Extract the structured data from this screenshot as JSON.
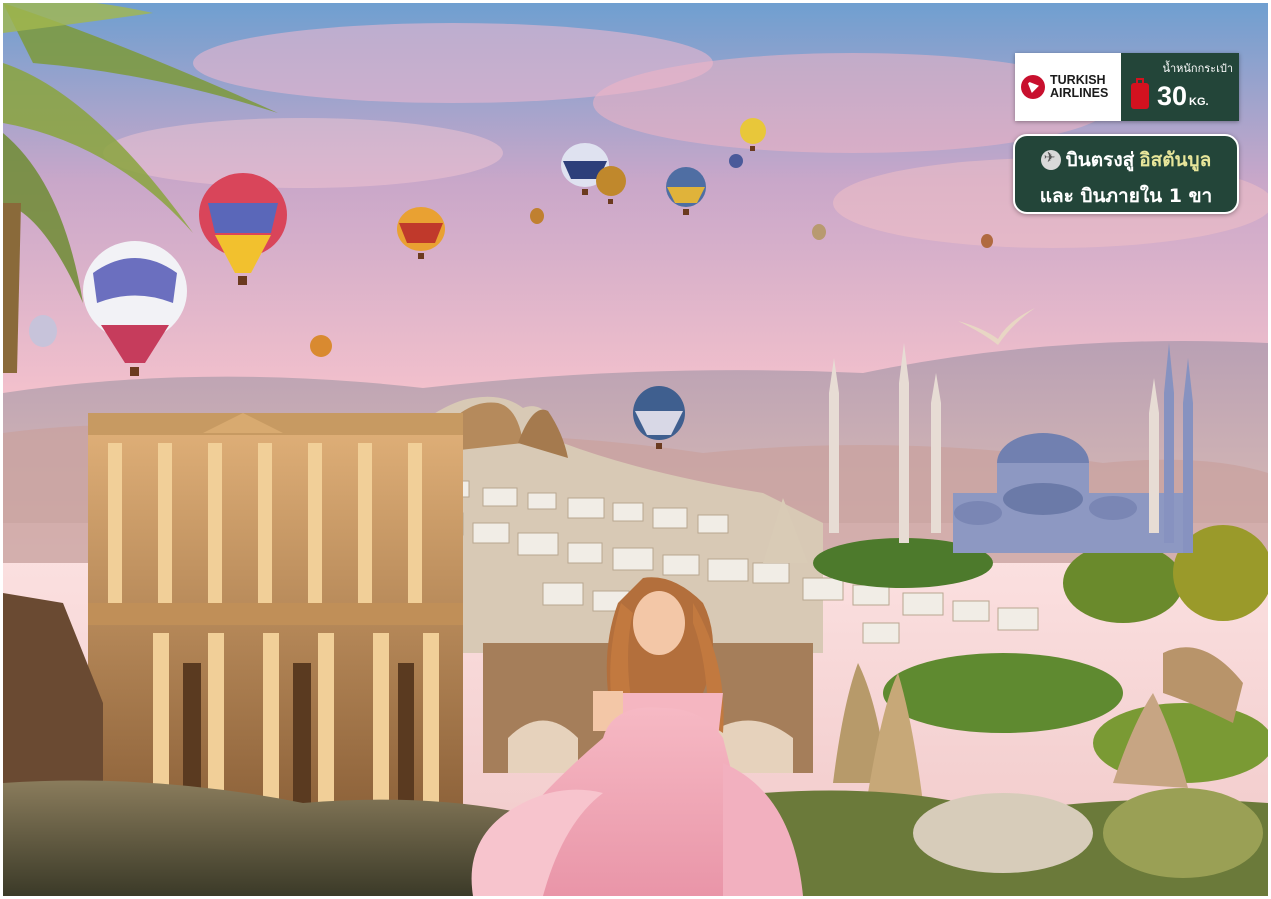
{
  "airline": {
    "name_line1": "TURKISH",
    "name_line2": "AIRLINES",
    "baggage_label": "น้ำหนักกระเป๋า",
    "baggage_weight": "30",
    "baggage_unit": "KG.",
    "logo_icon": "turkish-airlines-logo-icon",
    "bag_icon": "suitcase-icon"
  },
  "flight_info": {
    "line1_prefix": "บินตรงสู่",
    "line1_highlight": "อิสตันบูล",
    "line2": "และ บินภายใน 1 ขา",
    "icon": "plane-icon"
  },
  "colors": {
    "badge_green": "#234539",
    "highlight": "#e7e59a",
    "airline_red": "#c8102e"
  }
}
